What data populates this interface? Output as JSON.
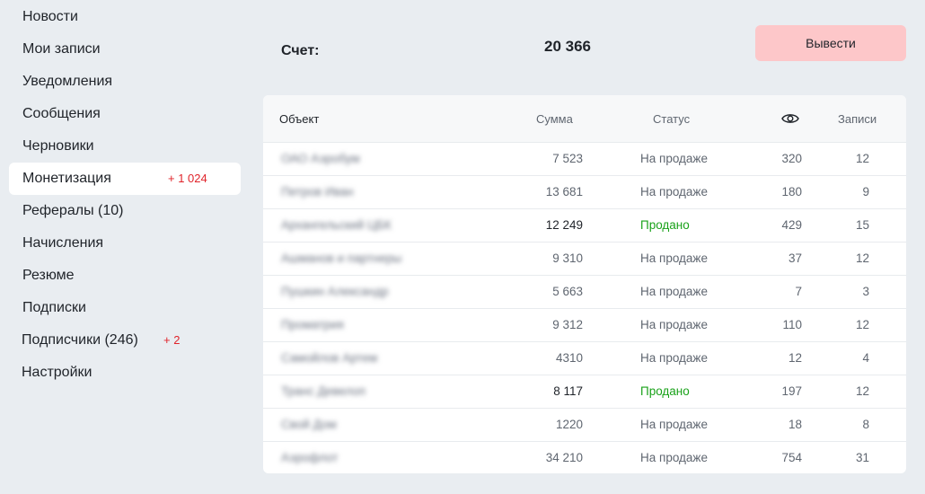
{
  "sidebar": {
    "items": [
      {
        "label": "Новости"
      },
      {
        "label": "Мои записи"
      },
      {
        "label": "Уведомления"
      },
      {
        "label": "Сообщения"
      },
      {
        "label": "Черновики"
      },
      {
        "label": "Монетизация",
        "badge": "+ 1 024",
        "active": true
      },
      {
        "label": "Рефералы (10)"
      },
      {
        "label": "Начисления"
      },
      {
        "label": "Резюме"
      },
      {
        "label": "Подписки"
      },
      {
        "label": "Подписчики (246)",
        "badge": "+ 2"
      },
      {
        "label": "Настройки"
      }
    ]
  },
  "account": {
    "label": "Счет:",
    "balance": "20 366",
    "withdraw_label": "Вывести"
  },
  "table": {
    "headers": {
      "object": "Объект",
      "sum": "Сумма",
      "status": "Статус",
      "views_icon": "eye-icon",
      "posts": "Записи"
    },
    "rows": [
      {
        "object": "ОАО Аэробум",
        "sum": "7 523",
        "status": "На продаже",
        "views": "320",
        "posts": "12",
        "sold": false
      },
      {
        "object": "Петров Иван",
        "sum": "13 681",
        "status": "На продаже",
        "views": "180",
        "posts": "9",
        "sold": false
      },
      {
        "object": "Архангельский ЦБК",
        "sum": "12 249",
        "status": "Продано",
        "views": "429",
        "posts": "15",
        "sold": true
      },
      {
        "object": "Ашманов и партнеры",
        "sum": "9 310",
        "status": "На продаже",
        "views": "37",
        "posts": "12",
        "sold": false
      },
      {
        "object": "Пушкин Александр",
        "sum": "5 663",
        "status": "На продаже",
        "views": "7",
        "posts": "3",
        "sold": false
      },
      {
        "object": "Проматрия",
        "sum": "9 312",
        "status": "На продаже",
        "views": "110",
        "posts": "12",
        "sold": false
      },
      {
        "object": "Самойлов Артем",
        "sum": "4310",
        "status": "На продаже",
        "views": "12",
        "posts": "4",
        "sold": false
      },
      {
        "object": "Транс Девелоп",
        "sum": "8 117",
        "status": "Продано",
        "views": "197",
        "posts": "12",
        "sold": true
      },
      {
        "object": "Свой Дом",
        "sum": "1220",
        "status": "На продаже",
        "views": "18",
        "posts": "8",
        "sold": false
      },
      {
        "object": "Аэрофлот",
        "sum": "34 210",
        "status": "На продаже",
        "views": "754",
        "posts": "31",
        "sold": false
      }
    ]
  },
  "colors": {
    "background": "#e9edf1",
    "withdraw_button": "#fdc7c9",
    "badge": "#e0242b",
    "sold_status": "#1aa21a"
  }
}
